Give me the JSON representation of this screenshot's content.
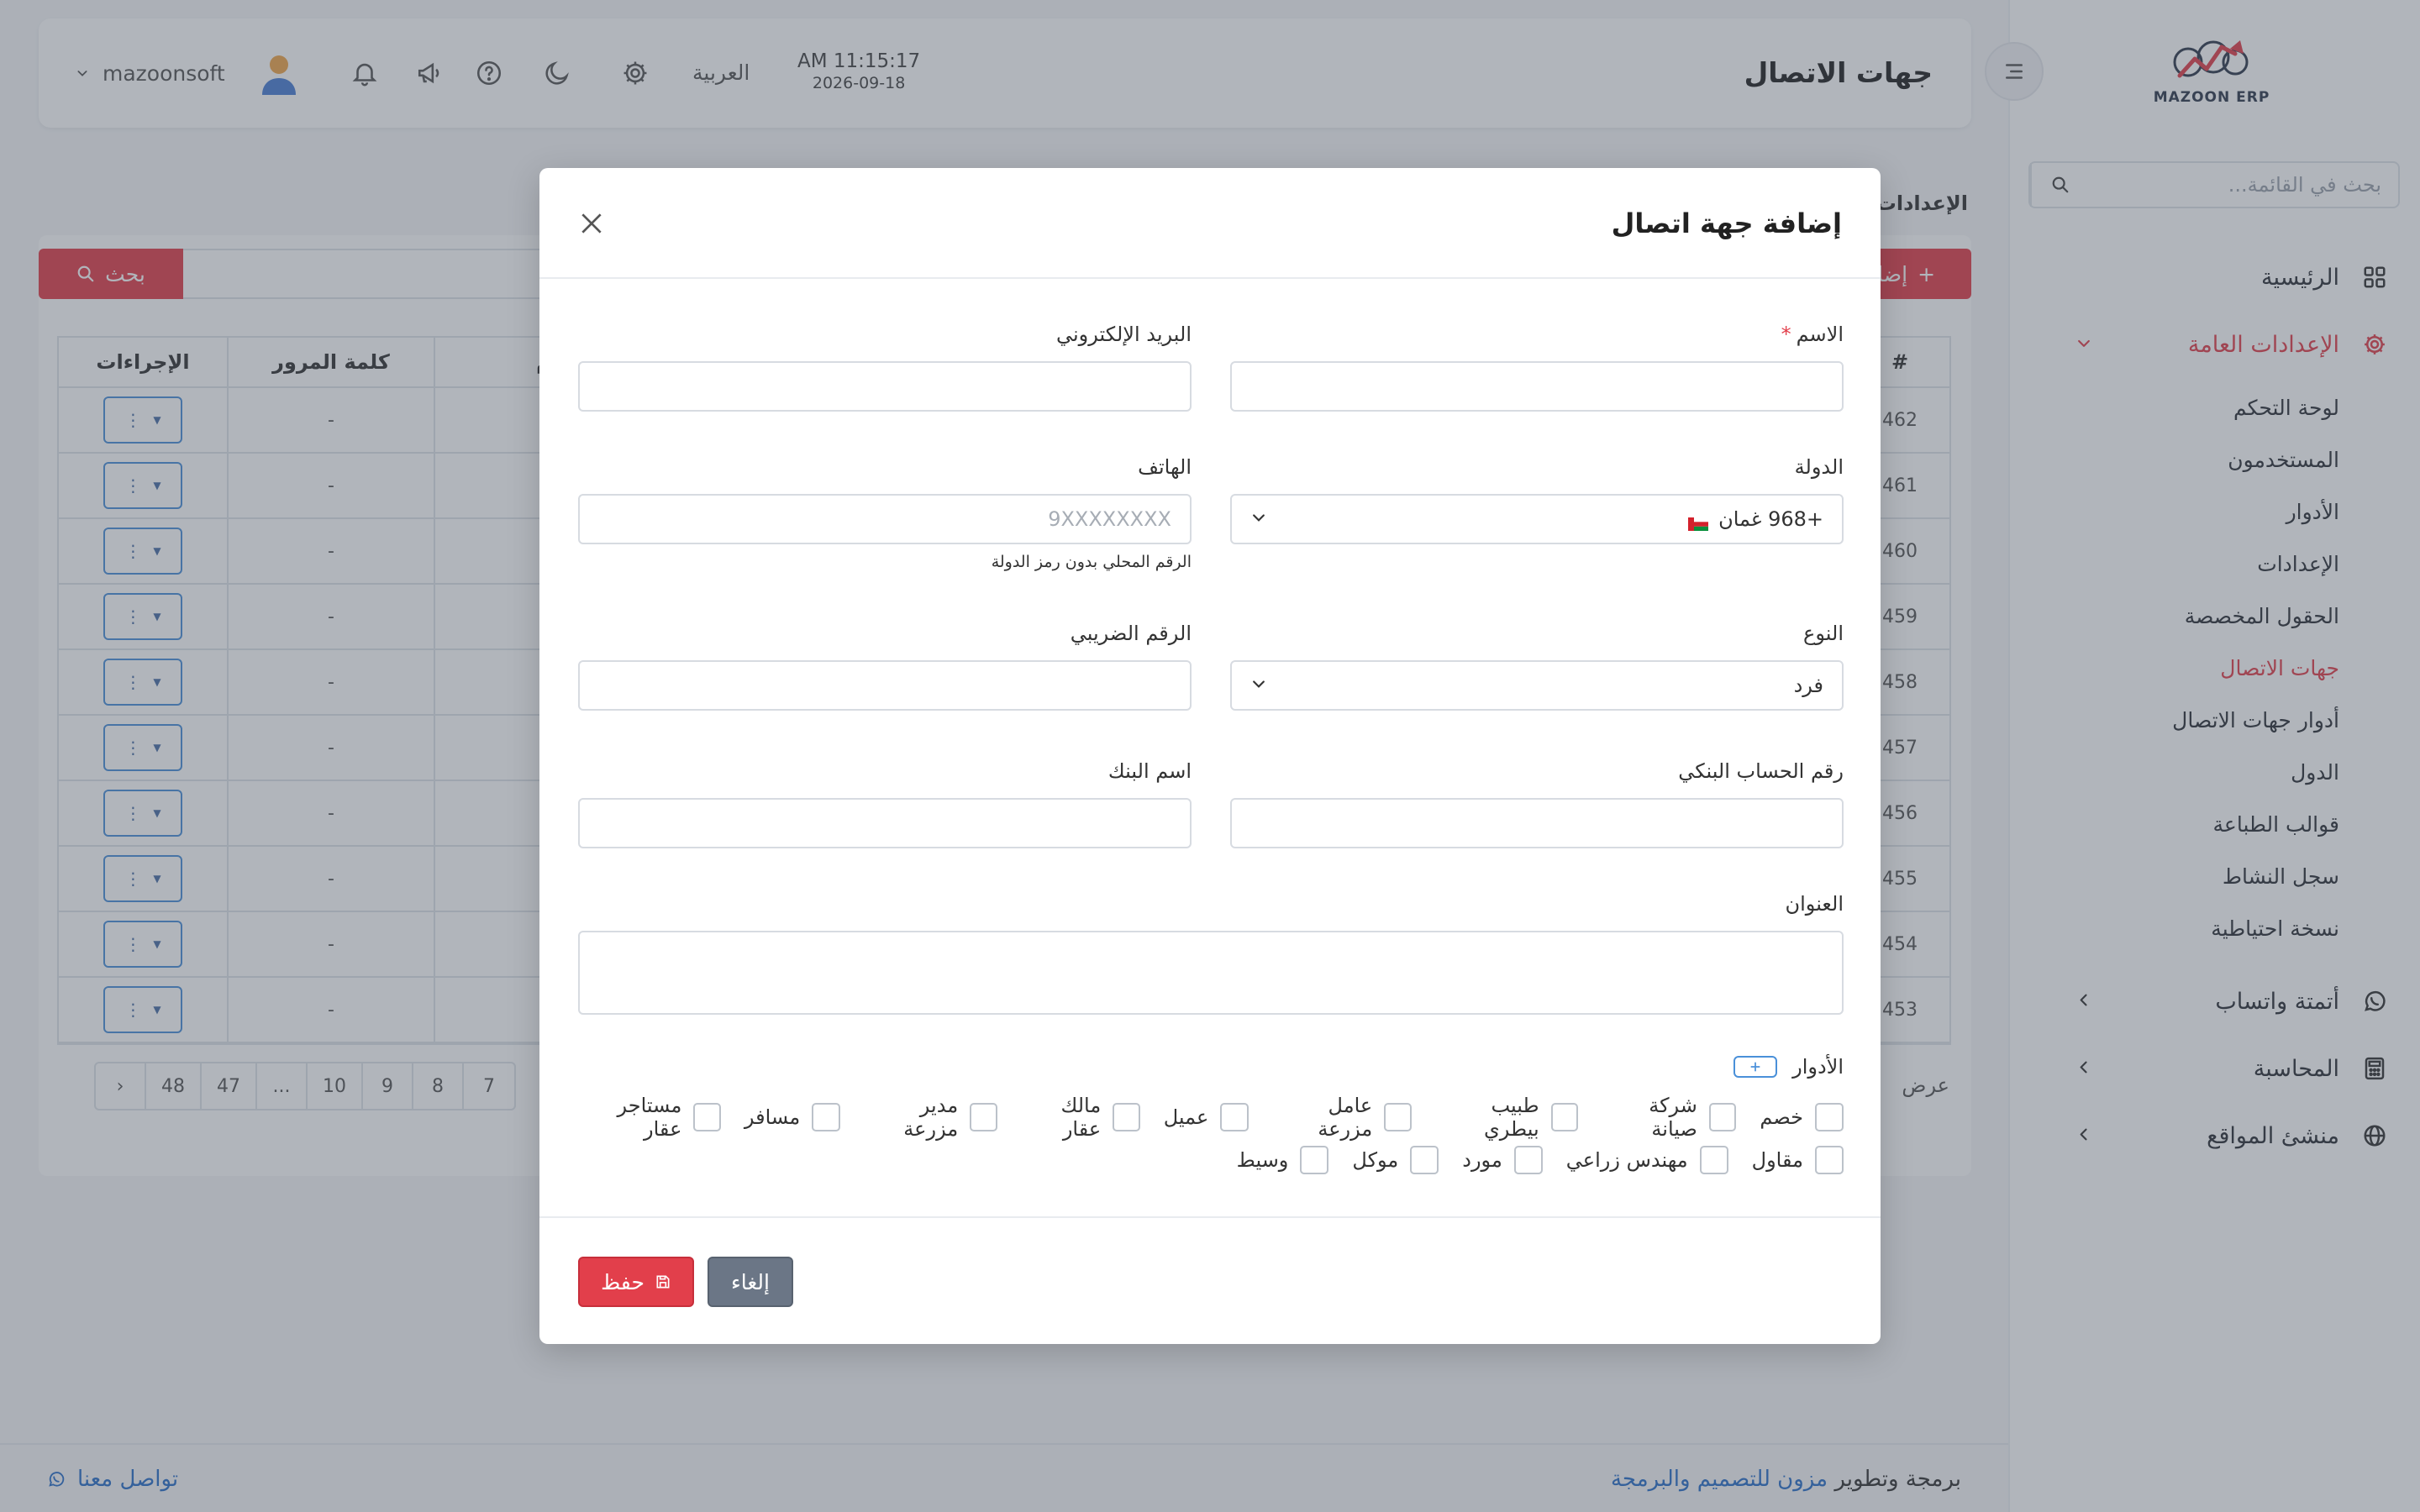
{
  "brand": {
    "logo_text": "MAZOON ERP",
    "accent": "#e23f4b"
  },
  "sidebar": {
    "search_placeholder": "بحث في القائمة...",
    "items": [
      {
        "label": "الرئيسية",
        "icon": "grid-icon"
      },
      {
        "label": "الإعدادات العامة",
        "icon": "gear-icon",
        "expanded": true
      },
      {
        "label": "أتمتة واتساب",
        "icon": "whatsapp-icon"
      },
      {
        "label": "المحاسبة",
        "icon": "calculator-icon"
      },
      {
        "label": "منشئ المواقع",
        "icon": "globe-icon"
      }
    ],
    "submenu": [
      {
        "label": "لوحة التحكم"
      },
      {
        "label": "المستخدمون"
      },
      {
        "label": "الأدوار"
      },
      {
        "label": "الإعدادات"
      },
      {
        "label": "الحقول المخصصة"
      },
      {
        "label": "جهات الاتصال",
        "active": true
      },
      {
        "label": "أدوار جهات الاتصال"
      },
      {
        "label": "الدول"
      },
      {
        "label": "قوالب الطباعة"
      },
      {
        "label": "سجل النشاط"
      },
      {
        "label": "نسخة احتياطية"
      }
    ]
  },
  "header": {
    "page_title": "جهات الاتصال",
    "time": "AM 11:15:17",
    "date": "2026-09-18",
    "language": "العربية",
    "username": "mazoonsoft"
  },
  "background": {
    "breadcrumb": "الإعدادات",
    "add_button": "إضافة",
    "search_button": "بحث",
    "columns": {
      "actions": "الإجراءات",
      "password": "كلمة المرور",
      "user": "تخدم",
      "id": "#"
    },
    "rows": [
      {
        "id": "462",
        "password": "-"
      },
      {
        "id": "461",
        "password": "-"
      },
      {
        "id": "460",
        "password": "-"
      },
      {
        "id": "459",
        "password": "-"
      },
      {
        "id": "458",
        "password": "-"
      },
      {
        "id": "457",
        "password": "-"
      },
      {
        "id": "456",
        "password": "-"
      },
      {
        "id": "455",
        "password": "-"
      },
      {
        "id": "454",
        "password": "-"
      },
      {
        "id": "453",
        "password": "-"
      }
    ],
    "pagination": [
      "›",
      "48",
      "47",
      "...",
      "10",
      "9",
      "8",
      "7"
    ],
    "showing_label": "عرض"
  },
  "footer": {
    "credit_prefix": "برمجة وتطوير",
    "credit_link": "مزون للتصميم والبرمجة",
    "contact": "تواصل معنا"
  },
  "modal": {
    "title": "إضافة جهة اتصال",
    "fields": {
      "name_label": "الاسم",
      "name_value": "",
      "email_label": "البريد الإلكتروني",
      "email_value": "",
      "country_label": "الدولة",
      "country_value": "+968  غمان",
      "phone_label": "الهاتف",
      "phone_placeholder": "9XXXXXXXX",
      "phone_hint": "الرقم المحلي بدون رمز الدولة",
      "type_label": "النوع",
      "type_value": "فرد",
      "tax_label": "الرقم الضريبي",
      "bank_account_label": "رقم الحساب البنكي",
      "bank_name_label": "اسم البنك",
      "address_label": "العنوان"
    },
    "roles_label": "الأدوار",
    "roles_row1": [
      "خصم",
      "شركة صيانة",
      "طبيب بيطري",
      "عامل مزرعة",
      "عميل",
      "مالك عقار",
      "مدير مزرعة",
      "مسافر",
      "مستاجر عقار"
    ],
    "roles_row2": [
      "مقاول",
      "مهندس زراعي",
      "مورد",
      "موكل",
      "وسيط"
    ],
    "save_button": "حفظ",
    "cancel_button": "إلغاء"
  }
}
